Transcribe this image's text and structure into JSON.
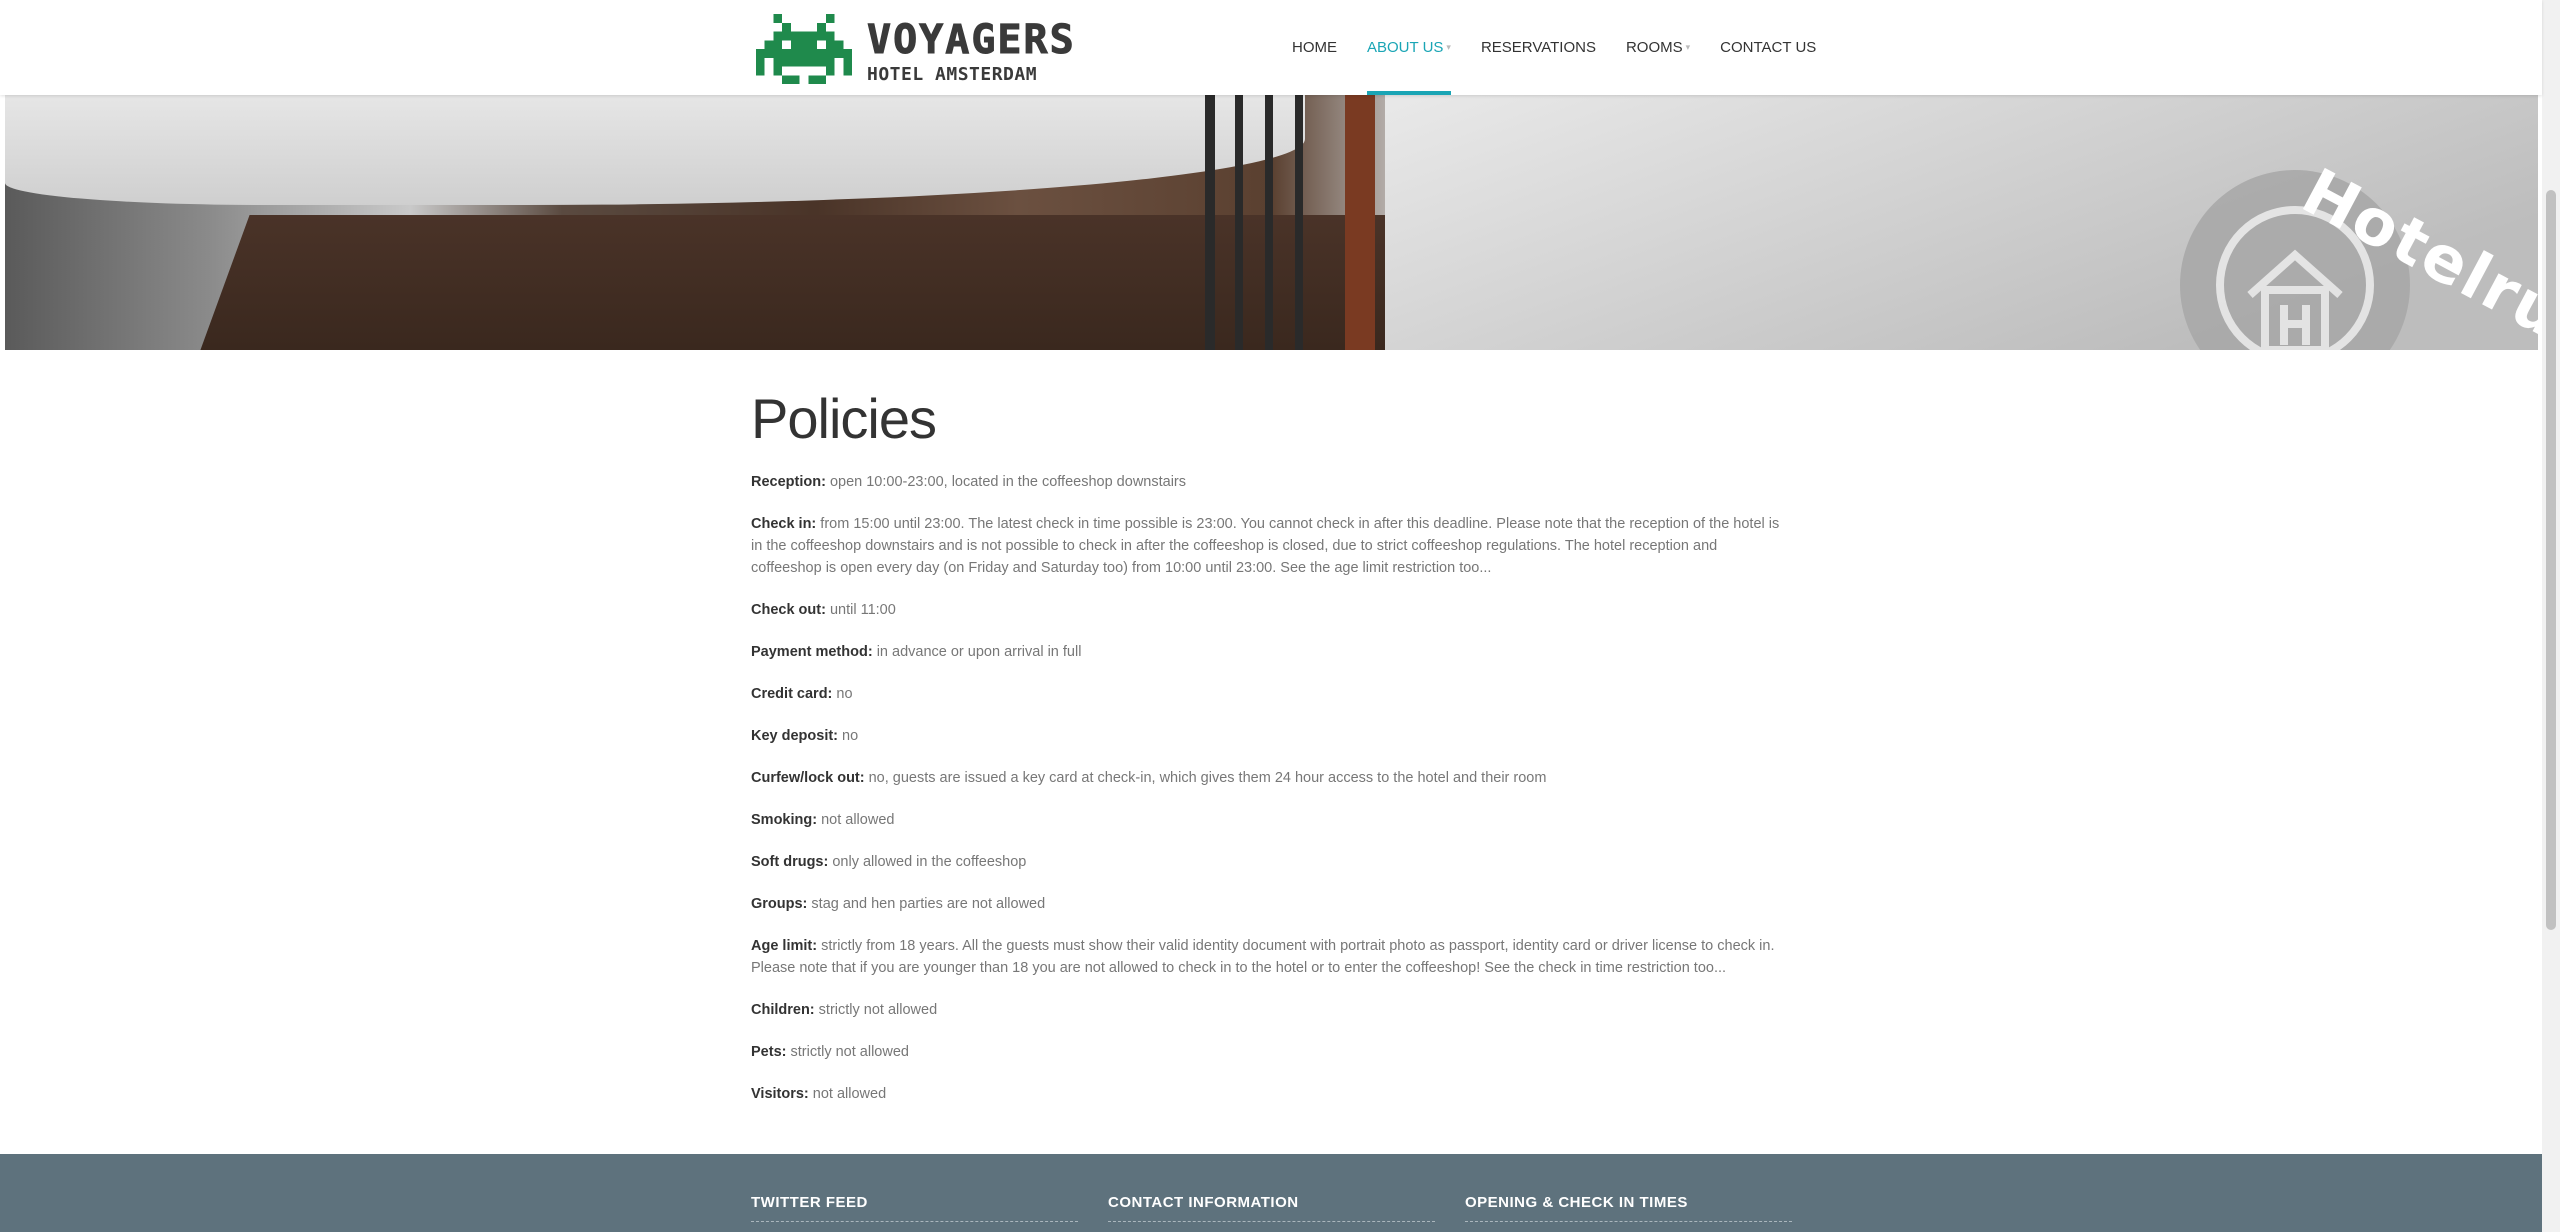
{
  "header": {
    "logo_title": "VOYAGERS",
    "logo_subtitle": "HOTEL AMSTERDAM",
    "nav": [
      {
        "label": "HOME",
        "active": false,
        "dropdown": false
      },
      {
        "label": "ABOUT US",
        "active": true,
        "dropdown": true
      },
      {
        "label": "RESERVATIONS",
        "active": false,
        "dropdown": false
      },
      {
        "label": "ROOMS",
        "active": false,
        "dropdown": true
      },
      {
        "label": "CONTACT US",
        "active": false,
        "dropdown": false
      }
    ],
    "accent_color": "#1aa5b5"
  },
  "banner": {
    "badge_text": "Hotelrun"
  },
  "main": {
    "title": "Policies",
    "policies": [
      {
        "label": "Reception:",
        "text": " open 10:00-23:00, located in the coffeeshop downstairs"
      },
      {
        "label": "Check in:",
        "text": " from 15:00 until 23:00. The latest check in time possible is 23:00. You cannot check in after this deadline. Please note that the reception of the hotel is in the coffeeshop downstairs and is not possible to check in after the coffeeshop is closed, due to strict coffeeshop regulations. The hotel reception and coffeeshop is open every day (on Friday and Saturday too) from 10:00 until 23:00. See the age limit restriction too..."
      },
      {
        "label": "Check out:",
        "text": " until 11:00"
      },
      {
        "label": "Payment method:",
        "text": " in advance or upon arrival in full"
      },
      {
        "label": "Credit card:",
        "text": " no"
      },
      {
        "label": "Key deposit:",
        "text": " no"
      },
      {
        "label": "Curfew/lock out:",
        "text": " no, guests are issued a key card at check-in, which gives them 24 hour access to the hotel and their room"
      },
      {
        "label": "Smoking:",
        "text": " not allowed"
      },
      {
        "label": "Soft drugs:",
        "text": " only allowed in the coffeeshop"
      },
      {
        "label": "Groups:",
        "text": " stag and hen parties are not allowed"
      },
      {
        "label": "Age limit:",
        "text": " strictly from 18 years. All the guests must show their valid identity document with portrait photo as passport, identity card or driver license to check in. Please note that if you are younger than 18 you are not allowed to check in to the hotel or to enter the coffeeshop! See the check in time restriction too..."
      },
      {
        "label": "Children:",
        "text": " strictly not allowed"
      },
      {
        "label": "Pets:",
        "text": " strictly not allowed"
      },
      {
        "label": "Visitors:",
        "text": " not allowed"
      }
    ]
  },
  "footer": {
    "columns": [
      "TWITTER FEED",
      "CONTACT INFORMATION",
      "OPENING & CHECK IN TIMES"
    ],
    "background": "#5e727d"
  }
}
